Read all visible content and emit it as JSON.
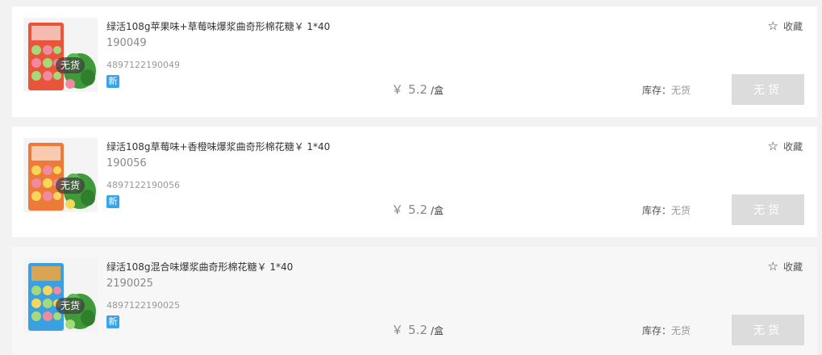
{
  "products": [
    {
      "name": "绿活108g苹果味+草莓味爆浆曲奇形棉花糖￥ 1*40",
      "code": "190049",
      "barcode": "4897122190049",
      "badge": "无货",
      "new_tag": "新",
      "price_symbol": "￥",
      "price": "5.2",
      "unit": "/盒",
      "stock_label": "库存：",
      "stock_value": "无货",
      "fav_label": "收藏",
      "button_label": "无货",
      "pack_color": "#e8553b",
      "candy_colors": [
        "#a6d97a",
        "#f08aa0"
      ]
    },
    {
      "name": "绿活108g草莓味+香橙味爆浆曲奇形棉花糖￥ 1*40",
      "code": "190056",
      "barcode": "4897122190056",
      "badge": "无货",
      "new_tag": "新",
      "price_symbol": "￥",
      "price": "5.2",
      "unit": "/盒",
      "stock_label": "库存：",
      "stock_value": "无货",
      "fav_label": "收藏",
      "button_label": "无货",
      "pack_color": "#ee7a3a",
      "candy_colors": [
        "#f6d65a",
        "#f08aa0"
      ]
    },
    {
      "name": "绿活108g混合味爆浆曲奇形棉花糖￥ 1*40",
      "code": "2190025",
      "barcode": "4897122190025",
      "badge": "无货",
      "new_tag": "新",
      "price_symbol": "￥",
      "price": "5.2",
      "unit": "/盒",
      "stock_label": "库存：",
      "stock_value": "无货",
      "fav_label": "收藏",
      "button_label": "无货",
      "pack_color": "#3aa0e0",
      "candy_colors": [
        "#a6d97a",
        "#f6d65a"
      ]
    }
  ]
}
